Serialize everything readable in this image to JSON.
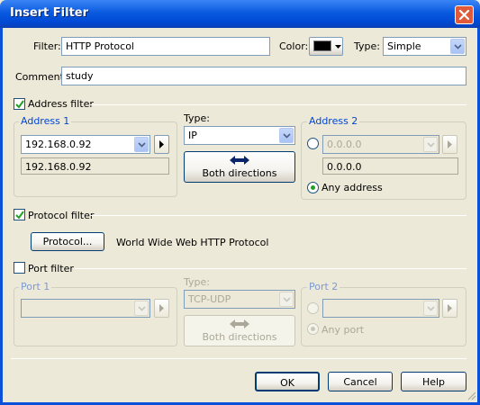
{
  "window": {
    "title": "Insert Filter"
  },
  "filter": {
    "label": "Filter:",
    "value": "HTTP Protocol"
  },
  "color": {
    "label": "Color:",
    "value": "#000000"
  },
  "type": {
    "label": "Type:",
    "value": "Simple"
  },
  "comment": {
    "label": "Comment:",
    "value": "study"
  },
  "address_filter": {
    "label": "Address filter",
    "checked": true,
    "address1": {
      "title": "Address 1",
      "value": "192.168.0.92",
      "resolved": "192.168.0.92"
    },
    "type": {
      "label": "Type:",
      "value": "IP"
    },
    "direction_button": "Both directions",
    "address2": {
      "title": "Address 2",
      "value": "0.0.0.0",
      "resolved": "0.0.0.0",
      "any_label": "Any address"
    }
  },
  "protocol_filter": {
    "label": "Protocol filter",
    "checked": true,
    "button": "Protocol...",
    "description": "World Wide Web HTTP Protocol"
  },
  "port_filter": {
    "label": "Port filter",
    "checked": false,
    "port1": {
      "title": "Port 1",
      "value": ""
    },
    "type": {
      "label": "Type:",
      "value": "TCP-UDP"
    },
    "direction_button": "Both directions",
    "port2": {
      "title": "Port 2",
      "value": "",
      "any_label": "Any port"
    }
  },
  "buttons": {
    "ok": "OK",
    "cancel": "Cancel",
    "help": "Help"
  }
}
